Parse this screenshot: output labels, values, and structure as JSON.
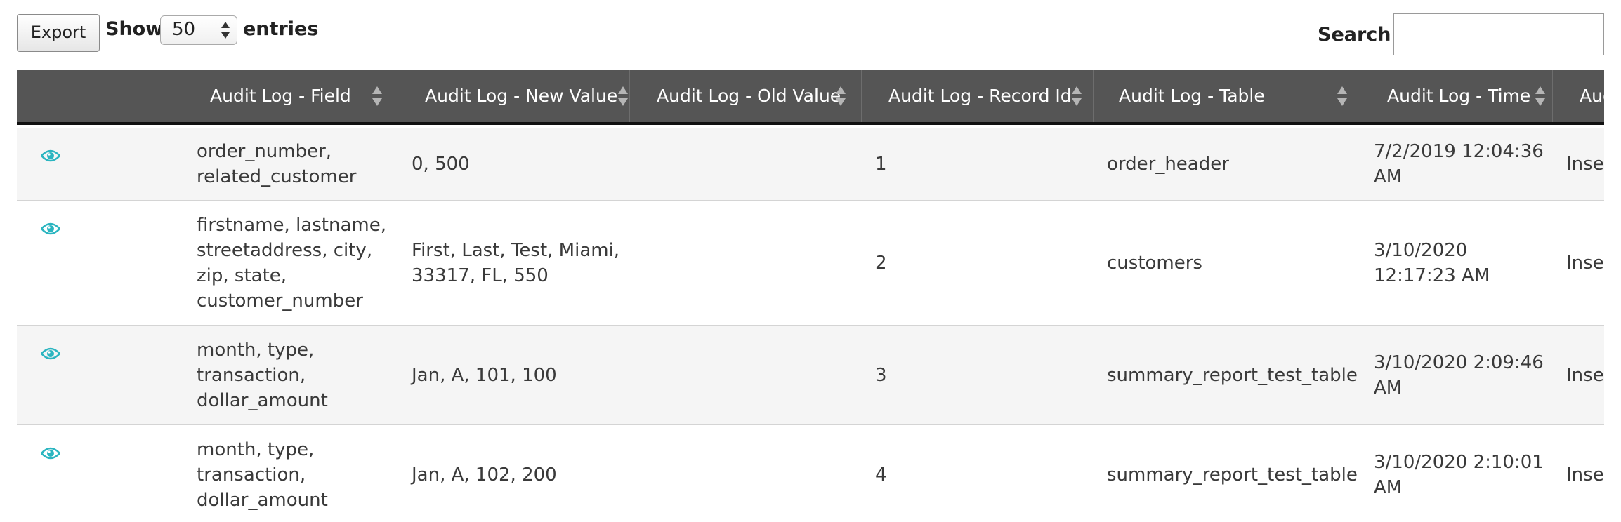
{
  "toolbar": {
    "export_label": "Export",
    "show_label": "Show",
    "entries_value": "50",
    "entries_label": "entries",
    "search_label": "Search:",
    "search_value": ""
  },
  "colors": {
    "header_bg": "#555555",
    "header_text": "#ffffff",
    "row_odd": "#f5f5f5",
    "row_even": "#ffffff",
    "eye_icon": "#2bb5c0"
  },
  "table": {
    "columns": [
      {
        "label": ""
      },
      {
        "label": "Audit Log - Field"
      },
      {
        "label": "Audit Log - New Value"
      },
      {
        "label": "Audit Log - Old Value"
      },
      {
        "label": "Audit Log - Record Id"
      },
      {
        "label": "Audit Log - Table"
      },
      {
        "label": "Audit Log - Time"
      },
      {
        "label": "Audi"
      }
    ],
    "rows": [
      {
        "action_icon": "eye-icon",
        "field": "order_number,\nrelated_customer",
        "new_value": "0, 500",
        "old_value": "",
        "record_id": "1",
        "table": "order_header",
        "time": "7/2/2019 12:04:36\nAM",
        "action": "Insert"
      },
      {
        "action_icon": "eye-icon",
        "field": "firstname, lastname,\nstreetaddress, city,\nzip, state,\ncustomer_number",
        "new_value": "First, Last, Test, Miami,\n33317, FL, 550",
        "old_value": "",
        "record_id": "2",
        "table": "customers",
        "time": "3/10/2020\n12:17:23 AM",
        "action": "Insert"
      },
      {
        "action_icon": "eye-icon",
        "field": "month, type,\ntransaction,\ndollar_amount",
        "new_value": "Jan, A, 101, 100",
        "old_value": "",
        "record_id": "3",
        "table": "summary_report_test_table",
        "time": "3/10/2020 2:09:46\nAM",
        "action": "Insert"
      },
      {
        "action_icon": "eye-icon",
        "field": "month, type,\ntransaction,\ndollar_amount",
        "new_value": "Jan, A, 102, 200",
        "old_value": "",
        "record_id": "4",
        "table": "summary_report_test_table",
        "time": "3/10/2020 2:10:01\nAM",
        "action": "Insert"
      }
    ]
  }
}
